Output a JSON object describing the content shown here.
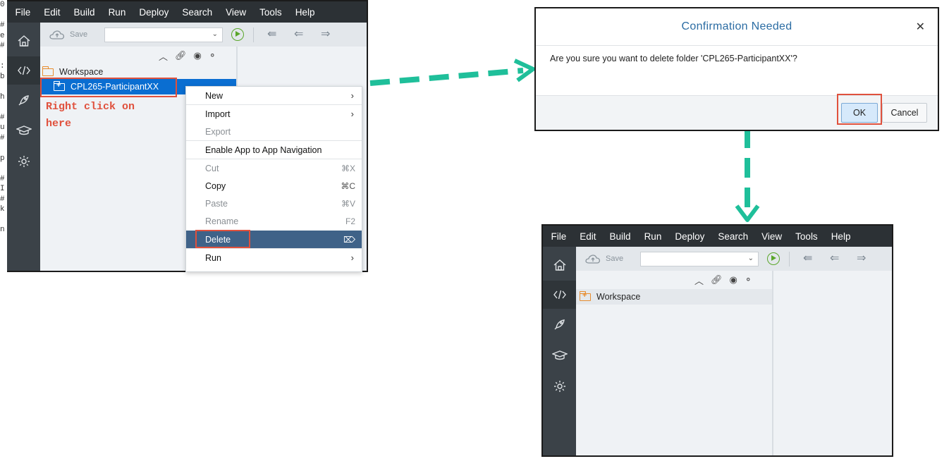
{
  "menu": [
    "File",
    "Edit",
    "Build",
    "Run",
    "Deploy",
    "Search",
    "View",
    "Tools",
    "Help"
  ],
  "toolbar": {
    "save_label": "Save"
  },
  "tree": {
    "workspace_label": "Workspace",
    "folder_label": "CPL265-ParticipantXX"
  },
  "annotation": {
    "line1": "Right click on",
    "line2": "here"
  },
  "context_menu": {
    "items": [
      {
        "label": "New",
        "shortcut": "",
        "submenu": true,
        "disabled": false
      },
      {
        "label": "Import",
        "shortcut": "",
        "submenu": true,
        "disabled": false
      },
      {
        "label": "Export",
        "shortcut": "",
        "submenu": false,
        "disabled": true
      },
      {
        "label": "Enable App to App Navigation",
        "shortcut": "",
        "submenu": false,
        "disabled": false
      },
      {
        "label": "Cut",
        "shortcut": "⌘X",
        "submenu": false,
        "disabled": true
      },
      {
        "label": "Copy",
        "shortcut": "⌘C",
        "submenu": false,
        "disabled": false
      },
      {
        "label": "Paste",
        "shortcut": "⌘V",
        "submenu": false,
        "disabled": true
      },
      {
        "label": "Rename",
        "shortcut": "F2",
        "submenu": false,
        "disabled": true
      },
      {
        "label": "Delete",
        "shortcut": "⌦",
        "submenu": false,
        "disabled": false,
        "selected": true
      },
      {
        "label": "Run",
        "shortcut": "",
        "submenu": true,
        "disabled": false
      }
    ]
  },
  "dialog": {
    "title": "Confirmation Needed",
    "close_icon": "close-icon",
    "message": "Are you sure you want to delete folder 'CPL265-ParticipantXX'?",
    "ok_label": "OK",
    "cancel_label": "Cancel"
  },
  "edge_text": [
    "0",
    "",
    "#",
    "e",
    "#",
    "",
    ":",
    "b",
    "",
    "h",
    "",
    "#",
    "u",
    "#",
    "",
    "p",
    "",
    "#",
    "I",
    "#",
    "k",
    "",
    "n"
  ],
  "colors": {
    "accent": "#3f6288",
    "highlight_box": "#e0513d",
    "arrow": "#1fbf9a",
    "menubar": "#2c3135",
    "sidebar": "#3b4248"
  }
}
